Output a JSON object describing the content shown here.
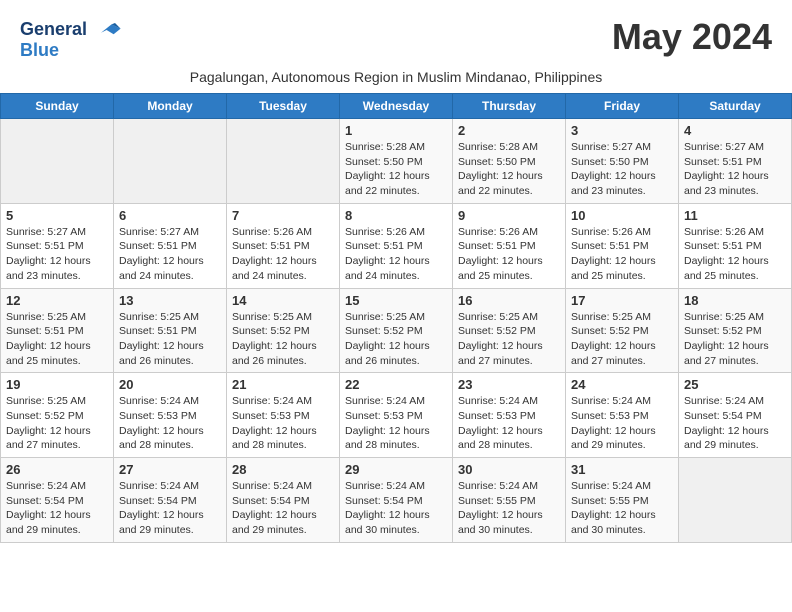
{
  "header": {
    "logo_line1": "General",
    "logo_line2": "Blue",
    "month_title": "May 2024",
    "subtitle": "Pagalungan, Autonomous Region in Muslim Mindanao, Philippines"
  },
  "days_of_week": [
    "Sunday",
    "Monday",
    "Tuesday",
    "Wednesday",
    "Thursday",
    "Friday",
    "Saturday"
  ],
  "weeks": [
    [
      {
        "day": "",
        "info": ""
      },
      {
        "day": "",
        "info": ""
      },
      {
        "day": "",
        "info": ""
      },
      {
        "day": "1",
        "info": "Sunrise: 5:28 AM\nSunset: 5:50 PM\nDaylight: 12 hours\nand 22 minutes."
      },
      {
        "day": "2",
        "info": "Sunrise: 5:28 AM\nSunset: 5:50 PM\nDaylight: 12 hours\nand 22 minutes."
      },
      {
        "day": "3",
        "info": "Sunrise: 5:27 AM\nSunset: 5:50 PM\nDaylight: 12 hours\nand 23 minutes."
      },
      {
        "day": "4",
        "info": "Sunrise: 5:27 AM\nSunset: 5:51 PM\nDaylight: 12 hours\nand 23 minutes."
      }
    ],
    [
      {
        "day": "5",
        "info": "Sunrise: 5:27 AM\nSunset: 5:51 PM\nDaylight: 12 hours\nand 23 minutes."
      },
      {
        "day": "6",
        "info": "Sunrise: 5:27 AM\nSunset: 5:51 PM\nDaylight: 12 hours\nand 24 minutes."
      },
      {
        "day": "7",
        "info": "Sunrise: 5:26 AM\nSunset: 5:51 PM\nDaylight: 12 hours\nand 24 minutes."
      },
      {
        "day": "8",
        "info": "Sunrise: 5:26 AM\nSunset: 5:51 PM\nDaylight: 12 hours\nand 24 minutes."
      },
      {
        "day": "9",
        "info": "Sunrise: 5:26 AM\nSunset: 5:51 PM\nDaylight: 12 hours\nand 25 minutes."
      },
      {
        "day": "10",
        "info": "Sunrise: 5:26 AM\nSunset: 5:51 PM\nDaylight: 12 hours\nand 25 minutes."
      },
      {
        "day": "11",
        "info": "Sunrise: 5:26 AM\nSunset: 5:51 PM\nDaylight: 12 hours\nand 25 minutes."
      }
    ],
    [
      {
        "day": "12",
        "info": "Sunrise: 5:25 AM\nSunset: 5:51 PM\nDaylight: 12 hours\nand 25 minutes."
      },
      {
        "day": "13",
        "info": "Sunrise: 5:25 AM\nSunset: 5:51 PM\nDaylight: 12 hours\nand 26 minutes."
      },
      {
        "day": "14",
        "info": "Sunrise: 5:25 AM\nSunset: 5:52 PM\nDaylight: 12 hours\nand 26 minutes."
      },
      {
        "day": "15",
        "info": "Sunrise: 5:25 AM\nSunset: 5:52 PM\nDaylight: 12 hours\nand 26 minutes."
      },
      {
        "day": "16",
        "info": "Sunrise: 5:25 AM\nSunset: 5:52 PM\nDaylight: 12 hours\nand 27 minutes."
      },
      {
        "day": "17",
        "info": "Sunrise: 5:25 AM\nSunset: 5:52 PM\nDaylight: 12 hours\nand 27 minutes."
      },
      {
        "day": "18",
        "info": "Sunrise: 5:25 AM\nSunset: 5:52 PM\nDaylight: 12 hours\nand 27 minutes."
      }
    ],
    [
      {
        "day": "19",
        "info": "Sunrise: 5:25 AM\nSunset: 5:52 PM\nDaylight: 12 hours\nand 27 minutes."
      },
      {
        "day": "20",
        "info": "Sunrise: 5:24 AM\nSunset: 5:53 PM\nDaylight: 12 hours\nand 28 minutes."
      },
      {
        "day": "21",
        "info": "Sunrise: 5:24 AM\nSunset: 5:53 PM\nDaylight: 12 hours\nand 28 minutes."
      },
      {
        "day": "22",
        "info": "Sunrise: 5:24 AM\nSunset: 5:53 PM\nDaylight: 12 hours\nand 28 minutes."
      },
      {
        "day": "23",
        "info": "Sunrise: 5:24 AM\nSunset: 5:53 PM\nDaylight: 12 hours\nand 28 minutes."
      },
      {
        "day": "24",
        "info": "Sunrise: 5:24 AM\nSunset: 5:53 PM\nDaylight: 12 hours\nand 29 minutes."
      },
      {
        "day": "25",
        "info": "Sunrise: 5:24 AM\nSunset: 5:54 PM\nDaylight: 12 hours\nand 29 minutes."
      }
    ],
    [
      {
        "day": "26",
        "info": "Sunrise: 5:24 AM\nSunset: 5:54 PM\nDaylight: 12 hours\nand 29 minutes."
      },
      {
        "day": "27",
        "info": "Sunrise: 5:24 AM\nSunset: 5:54 PM\nDaylight: 12 hours\nand 29 minutes."
      },
      {
        "day": "28",
        "info": "Sunrise: 5:24 AM\nSunset: 5:54 PM\nDaylight: 12 hours\nand 29 minutes."
      },
      {
        "day": "29",
        "info": "Sunrise: 5:24 AM\nSunset: 5:54 PM\nDaylight: 12 hours\nand 30 minutes."
      },
      {
        "day": "30",
        "info": "Sunrise: 5:24 AM\nSunset: 5:55 PM\nDaylight: 12 hours\nand 30 minutes."
      },
      {
        "day": "31",
        "info": "Sunrise: 5:24 AM\nSunset: 5:55 PM\nDaylight: 12 hours\nand 30 minutes."
      },
      {
        "day": "",
        "info": ""
      }
    ]
  ]
}
